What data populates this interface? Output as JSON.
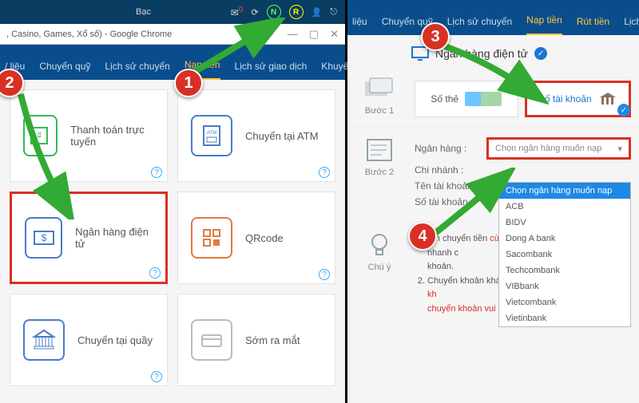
{
  "topbar": {
    "level": "Bạc",
    "mail_badge": "0"
  },
  "browser": {
    "tab_title": ", Casino, Games, Xổ số) - Google Chrome"
  },
  "nav_left": {
    "items": [
      "/ liệu",
      "Chuyển quỹ",
      "Lịch sử chuyển",
      "Nạp tiền",
      "Lịch sử giao dịch",
      "Khuyến mãi"
    ],
    "active_index": 3
  },
  "nav_right": {
    "items": [
      "liệu",
      "Chuyển quỹ",
      "Lịch sử chuyển",
      "Nạp tiền",
      "Rút tiền",
      "Lịch s"
    ],
    "active_index": 3
  },
  "cards": [
    {
      "label": "Thanh toán trực tuyến",
      "icon": "money"
    },
    {
      "label": "Chuyển tại ATM",
      "icon": "atm"
    },
    {
      "label": "Ngân hàng điện tử",
      "icon": "ebank",
      "highlight": true
    },
    {
      "label": "QRcode",
      "icon": "qr"
    },
    {
      "label": "Chuyển tại quầy",
      "icon": "bank"
    },
    {
      "label": "Sớm ra mắt",
      "icon": "card"
    }
  ],
  "right": {
    "title": "Ngân hàng điện tử",
    "step1_label": "Bước 1",
    "step2_label": "Bước 2",
    "note_label": "Chú ý",
    "method_card": "Số thẻ",
    "method_account": "Số tài khoản",
    "form": {
      "bank_label": "Ngân hàng :",
      "bank_placeholder": "Chọn ngân hàng muốn nạp",
      "branch_label": "Chi nhánh :",
      "acc_name_label": "Tên tài khoản :",
      "acc_num_label": "Số tài khoản :"
    },
    "bank_options": [
      "Chọn ngân hàng muốn nạp",
      "ACB",
      "BIDV",
      "Dong A bank",
      "Sacombank",
      "Techcombank",
      "VIBbank",
      "Vietcombank",
      "Vietinbank"
    ],
    "notes": {
      "n1_a": "Xin chuyển tiền ",
      "n1_b": "cùng hệ thống ngân hàng",
      "n1_c": ", để nhanh c",
      "n1_d": "khoản.",
      "n2_a": "Chuyển khoản khác hệ thống vui lòng chọn ",
      "n2_b": "chuyển kh",
      "n2_c": "chuyển khoản vui lòng điền họ tên."
    }
  },
  "markers": {
    "m1": "1",
    "m2": "2",
    "m3": "3",
    "m4": "4"
  }
}
